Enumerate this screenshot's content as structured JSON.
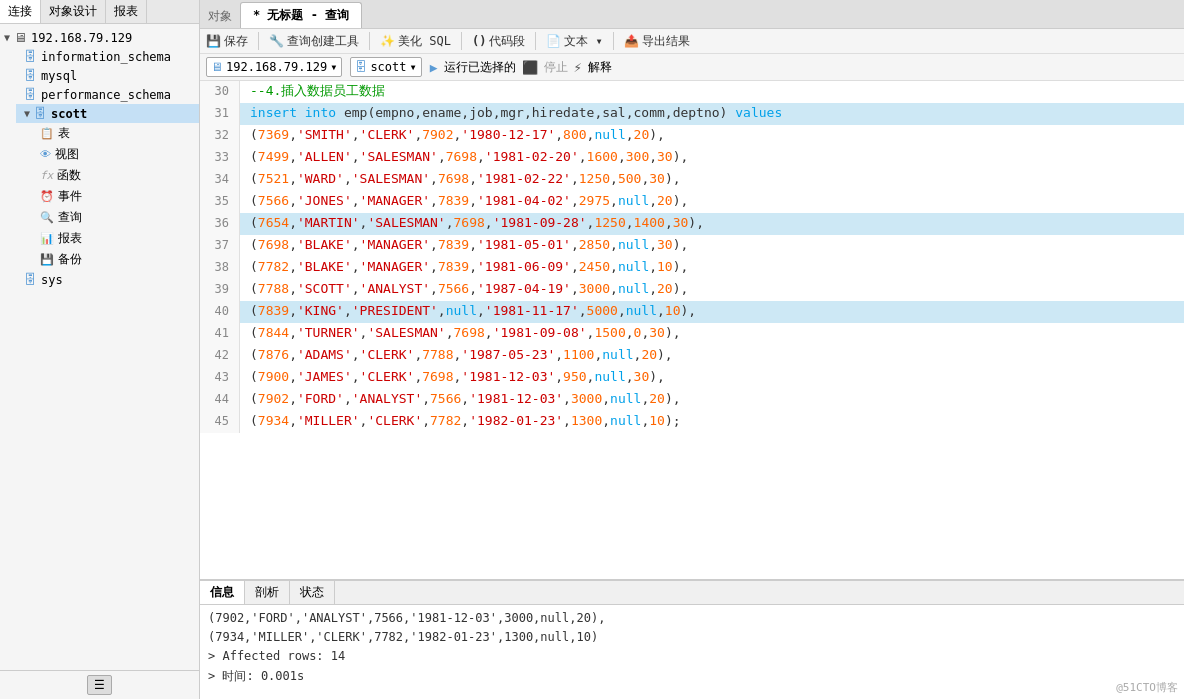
{
  "sidebar": {
    "top_tabs": [
      "连接",
      "对象设计",
      "报表"
    ],
    "active_tab": "连接",
    "items": [
      {
        "id": "server",
        "label": "192.168.79.129",
        "icon": "🖥",
        "level": 0,
        "expanded": true
      },
      {
        "id": "information_schema",
        "label": "information_schema",
        "icon": "🗄",
        "level": 1
      },
      {
        "id": "mysql",
        "label": "mysql",
        "icon": "🗄",
        "level": 1
      },
      {
        "id": "performance_schema",
        "label": "performance_schema",
        "icon": "🗄",
        "level": 1
      },
      {
        "id": "scott",
        "label": "scott",
        "icon": "🗄",
        "level": 1,
        "expanded": true,
        "selected": true
      },
      {
        "id": "tables",
        "label": "表",
        "icon": "📋",
        "level": 2
      },
      {
        "id": "views",
        "label": "视图",
        "icon": "👁",
        "level": 2
      },
      {
        "id": "functions",
        "label": "函数",
        "icon": "fx",
        "level": 2
      },
      {
        "id": "events",
        "label": "事件",
        "icon": "⏰",
        "level": 2
      },
      {
        "id": "queries",
        "label": "查询",
        "icon": "🔍",
        "level": 2
      },
      {
        "id": "reports",
        "label": "报表",
        "icon": "📊",
        "level": 2
      },
      {
        "id": "backups",
        "label": "备份",
        "icon": "💾",
        "level": 2
      },
      {
        "id": "sys",
        "label": "sys",
        "icon": "🗄",
        "level": 1
      }
    ]
  },
  "main": {
    "tabs": [
      {
        "id": "query1",
        "label": "* 无标题 - 查询",
        "active": true
      }
    ],
    "toolbar": {
      "buttons": [
        {
          "id": "save",
          "icon": "💾",
          "label": "保存"
        },
        {
          "id": "query-tool",
          "icon": "🔧",
          "label": "查询创建工具"
        },
        {
          "id": "beautify",
          "icon": "✨",
          "label": "美化 SQL"
        },
        {
          "id": "snippet",
          "icon": "()",
          "label": "代码段"
        },
        {
          "id": "text",
          "icon": "📄",
          "label": "文本"
        },
        {
          "id": "export",
          "icon": "📤",
          "label": "导出结果"
        }
      ]
    },
    "query_bar": {
      "server": "192.168.79.129",
      "database": "scott",
      "run_label": "运行已选择的",
      "stop_label": "停止",
      "explain_label": "解释"
    }
  },
  "code": {
    "lines": [
      {
        "num": 30,
        "content": "--4.插入数据员工数据",
        "type": "comment",
        "highlighted": false
      },
      {
        "num": 31,
        "content": "insert into emp(empno,ename,job,mgr,hiredate,sal,comm,deptno) values",
        "type": "sql",
        "highlighted": true
      },
      {
        "num": 32,
        "content": "(7369,'SMITH','CLERK',7902,'1980-12-17',800,null,20),",
        "type": "data",
        "highlighted": false
      },
      {
        "num": 33,
        "content": "(7499,'ALLEN','SALESMAN',7698,'1981-02-20',1600,300,30),",
        "type": "data",
        "highlighted": false
      },
      {
        "num": 34,
        "content": "(7521,'WARD','SALESMAN',7698,'1981-02-22',1250,500,30),",
        "type": "data",
        "highlighted": false
      },
      {
        "num": 35,
        "content": "(7566,'JONES','MANAGER',7839,'1981-04-02',2975,null,20),",
        "type": "data",
        "highlighted": false
      },
      {
        "num": 36,
        "content": "(7654,'MARTIN','SALESMAN',7698,'1981-09-28',1250,1400,30),",
        "type": "data",
        "highlighted": true
      },
      {
        "num": 37,
        "content": "(7698,'BLAKE','MANAGER',7839,'1981-05-01',2850,null,30),",
        "type": "data",
        "highlighted": false
      },
      {
        "num": 38,
        "content": "(7782,'BLAKE','MANAGER',7839,'1981-06-09',2450,null,10),",
        "type": "data",
        "highlighted": false
      },
      {
        "num": 39,
        "content": "(7788,'SCOTT','ANALYST',7566,'1987-04-19',3000,null,20),",
        "type": "data",
        "highlighted": false
      },
      {
        "num": 40,
        "content": "(7839,'KING','PRESIDENT',null,'1981-11-17',5000,null,10),",
        "type": "data",
        "highlighted": true
      },
      {
        "num": 41,
        "content": "(7844,'TURNER','SALESMAN',7698,'1981-09-08',1500,0,30),",
        "type": "data",
        "highlighted": false
      },
      {
        "num": 42,
        "content": "(7876,'ADAMS','CLERK',7788,'1987-05-23',1100,null,20),",
        "type": "data",
        "highlighted": false
      },
      {
        "num": 43,
        "content": "(7900,'JAMES','CLERK',7698,'1981-12-03',950,null,30),",
        "type": "data",
        "highlighted": false
      },
      {
        "num": 44,
        "content": "(7902,'FORD','ANALYST',7566,'1981-12-03',3000,null,20),",
        "type": "data",
        "highlighted": false
      },
      {
        "num": 45,
        "content": "(7934,'MILLER','CLERK',7782,'1982-01-23',1300,null,10);",
        "type": "data",
        "highlighted": false
      }
    ]
  },
  "bottom": {
    "tabs": [
      "信息",
      "剖析",
      "状态"
    ],
    "active_tab": "信息",
    "content": "(7902,'FORD','ANALYST',7566,'1981-12-03',3000,null,20),\n(7934,'MILLER','CLERK',7782,'1982-01-23',1300,null,10)\n> Affected rows: 14\n> 时间: 0.001s"
  },
  "watermark": "@51CTO博客"
}
